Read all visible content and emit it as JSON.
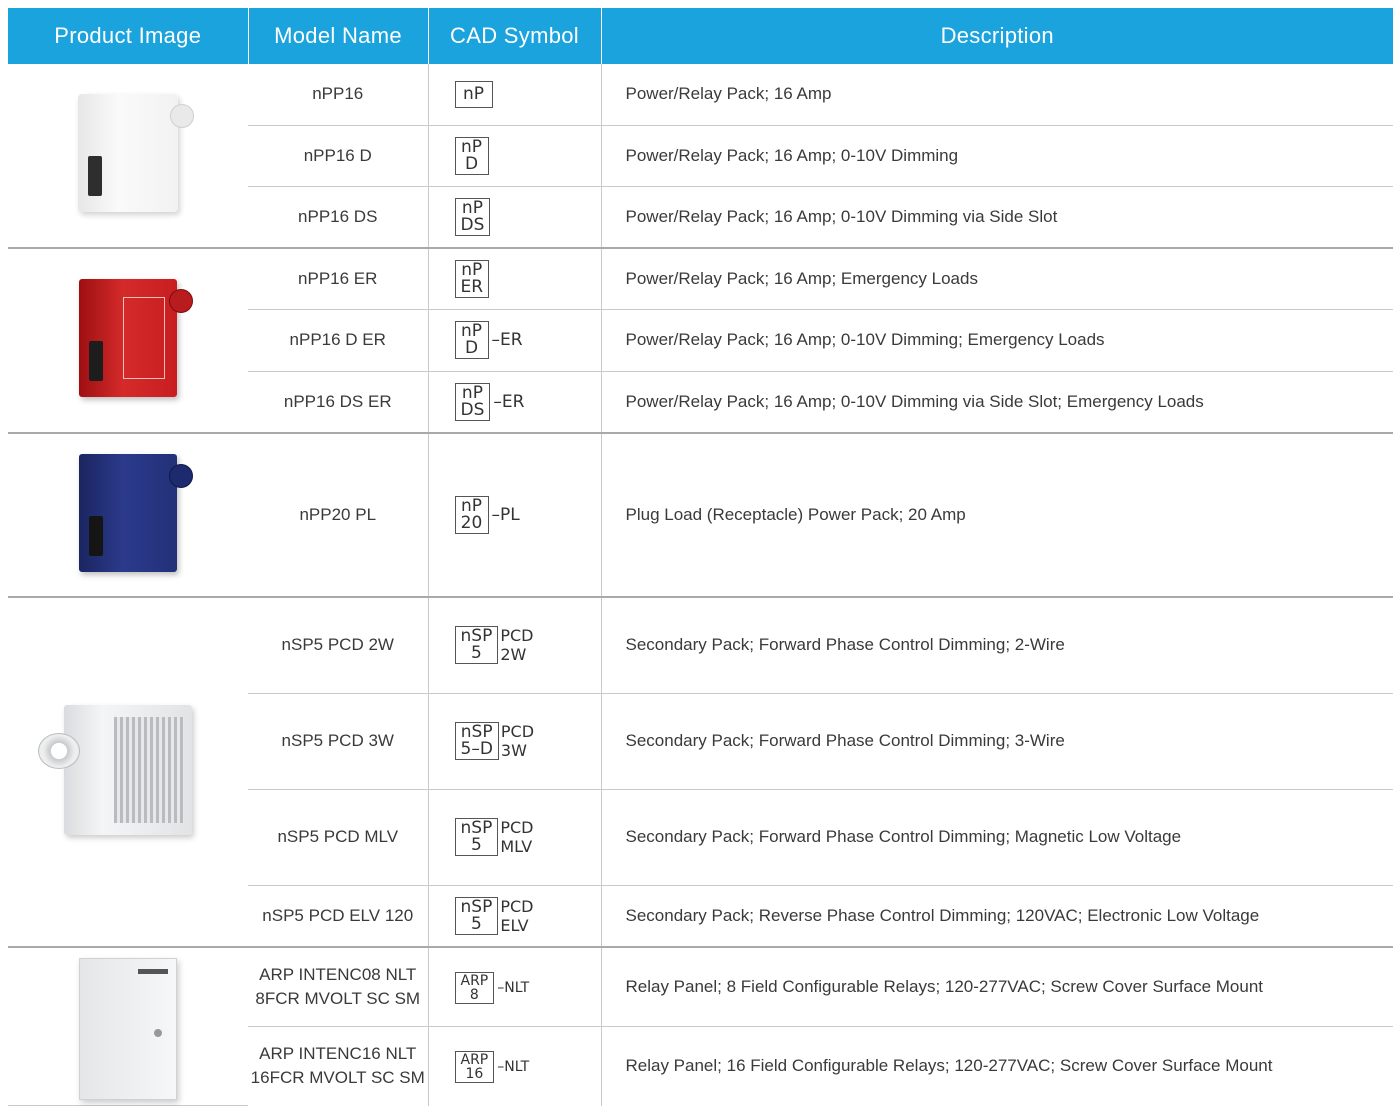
{
  "header": {
    "product_image": "Product Image",
    "model_name": "Model Name",
    "cad_symbol": "CAD Symbol",
    "description": "Description"
  },
  "rows": [
    {
      "model": "nPP16",
      "cad_top": "nP",
      "cad_bottom": "",
      "cad_suffix": "",
      "description": "Power/Relay Pack; 16 Amp"
    },
    {
      "model": "nPP16 D",
      "cad_top": "nP",
      "cad_bottom": "D",
      "cad_suffix": "",
      "description": "Power/Relay Pack; 16 Amp; 0-10V Dimming"
    },
    {
      "model": "nPP16 DS",
      "cad_top": "nP",
      "cad_bottom": "DS",
      "cad_suffix": "",
      "description": "Power/Relay Pack; 16 Amp; 0-10V Dimming via Side Slot"
    },
    {
      "model": "nPP16 ER",
      "cad_top": "nP",
      "cad_bottom": "ER",
      "cad_suffix": "",
      "description": "Power/Relay Pack; 16 Amp; Emergency Loads"
    },
    {
      "model": "nPP16 D ER",
      "cad_top": "nP",
      "cad_bottom": "D",
      "cad_suffix": "–ER",
      "description": "Power/Relay Pack; 16 Amp; 0-10V Dimming; Emergency Loads"
    },
    {
      "model": "nPP16 DS ER",
      "cad_top": "nP",
      "cad_bottom": "DS",
      "cad_suffix": "–ER",
      "description": "Power/Relay Pack; 16 Amp; 0-10V Dimming via Side Slot; Emergency Loads"
    },
    {
      "model": "nPP20 PL",
      "cad_top": "nP",
      "cad_bottom": "20",
      "cad_suffix": "–PL",
      "description": "Plug Load (Receptacle) Power Pack; 20 Amp"
    },
    {
      "model": "nSP5 PCD 2W",
      "cad_top": "nSP",
      "cad_bottom": "5",
      "cad_r1": "PCD",
      "cad_r2": "2W",
      "description": "Secondary Pack; Forward Phase Control Dimming; 2-Wire"
    },
    {
      "model": "nSP5 PCD 3W",
      "cad_top": "nSP",
      "cad_bottom": "5–D",
      "cad_r1": "PCD",
      "cad_r2": "3W",
      "description": "Secondary Pack; Forward Phase Control Dimming; 3-Wire"
    },
    {
      "model": "nSP5 PCD MLV",
      "cad_top": "nSP",
      "cad_bottom": "5",
      "cad_r1": "PCD",
      "cad_r2": "MLV",
      "description": "Secondary Pack; Forward Phase Control Dimming; Magnetic Low Voltage"
    },
    {
      "model": "nSP5 PCD ELV 120",
      "cad_top": "nSP",
      "cad_bottom": "5",
      "cad_r1": "PCD",
      "cad_r2": "ELV",
      "description": "Secondary Pack; Reverse Phase Control Dimming; 120VAC; Electronic Low Voltage"
    },
    {
      "model_line1": "ARP INTENC08 NLT",
      "model_line2": "8FCR MVOLT SC SM",
      "cad_top": "ARP",
      "cad_bottom": "8",
      "cad_suffix": "–NLT",
      "description": "Relay Panel; 8 Field Configurable Relays; 120-277VAC; Screw Cover Surface Mount"
    },
    {
      "model_line1": "ARP INTENC16 NLT",
      "model_line2": "16FCR MVOLT SC SM",
      "cad_top": "ARP",
      "cad_bottom": "16",
      "cad_suffix": "–NLT",
      "description": "Relay Panel; 16 Field Configurable Relays; 120-277VAC; Screw Cover Surface Mount"
    }
  ],
  "colors": {
    "header_bg": "#1aa3dc",
    "header_text": "#ffffff",
    "divider": "#c9c9c9"
  }
}
